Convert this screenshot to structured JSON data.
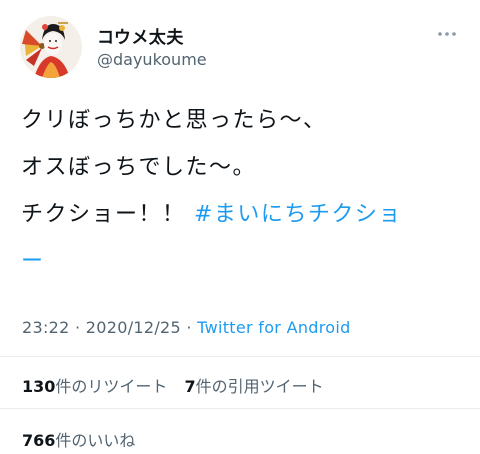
{
  "author": {
    "display_name": "コウメ太夫",
    "handle": "@dayukoume"
  },
  "tweet": {
    "line1": "クリぼっちかと思ったら〜、",
    "line2": "オスぼっちでした〜。",
    "line3_text": "チクショー！！ ",
    "hashtag": "#まいにちチクショ",
    "hashtag_cont": "ー"
  },
  "meta": {
    "time": "23:22",
    "separator1": " · ",
    "date": "2020/12/25",
    "separator2": " · ",
    "source": "Twitter for Android"
  },
  "stats": {
    "retweets_count": "130",
    "retweets_label": "件のリツイート",
    "quotes_count": "7",
    "quotes_label": "件の引用ツイート",
    "likes_count": "766",
    "likes_label": "件のいいね"
  },
  "icons": {
    "more": "more-dots-icon",
    "avatar": "avatar-image"
  },
  "colors": {
    "accent": "#1d9bf0",
    "text": "#0f1419",
    "secondary": "#536471",
    "divider": "#e6ecf0"
  }
}
